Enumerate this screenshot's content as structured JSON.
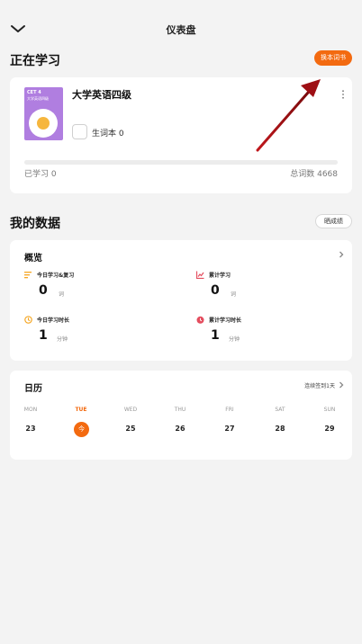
{
  "header": {
    "title": "仪表盘",
    "back_icon": "chevron-down-icon"
  },
  "studying": {
    "section_title": "正在学习",
    "change_book_label": "换本词书",
    "book": {
      "name": "大学英语四级",
      "cover_code": "CET 4",
      "cover_subtitle": "大学英语四级",
      "cover_color": "#b07ee0"
    },
    "vocab_book_label": "生词本",
    "vocab_book_count": "0",
    "learned_label": "已学习",
    "learned_count": "0",
    "total_label": "总词数",
    "total_count": "4668",
    "progress_fraction": 0
  },
  "my_data": {
    "section_title": "我的数据",
    "share_label": "晒成绩",
    "overview": {
      "title": "概览",
      "stats": [
        {
          "label": "今日学习&复习",
          "value": "0",
          "unit": "词",
          "icon": "list-icon",
          "icon_color": "#f5a623"
        },
        {
          "label": "累计学习",
          "value": "0",
          "unit": "词",
          "icon": "chart-icon",
          "icon_color": "#e44d5e"
        },
        {
          "label": "今日学习时长",
          "value": "1",
          "unit": "分钟",
          "icon": "clock-icon",
          "icon_color": "#f5a623"
        },
        {
          "label": "累计学习时长",
          "value": "1",
          "unit": "分钟",
          "icon": "alarm-clock-icon",
          "icon_color": "#e44d5e"
        }
      ]
    }
  },
  "calendar": {
    "title": "日历",
    "streak_label": "连续签到1天",
    "days": [
      {
        "weekday": "MON",
        "date": "23"
      },
      {
        "weekday": "TUE",
        "date": "今"
      },
      {
        "weekday": "WED",
        "date": "25"
      },
      {
        "weekday": "THU",
        "date": "26"
      },
      {
        "weekday": "FRI",
        "date": "27"
      },
      {
        "weekday": "SAT",
        "date": "28"
      },
      {
        "weekday": "SUN",
        "date": "29"
      }
    ],
    "today_index": 1
  },
  "colors": {
    "accent": "#f36a10",
    "annotation_arrow": "#c0171c",
    "background": "#f3f3f3"
  }
}
